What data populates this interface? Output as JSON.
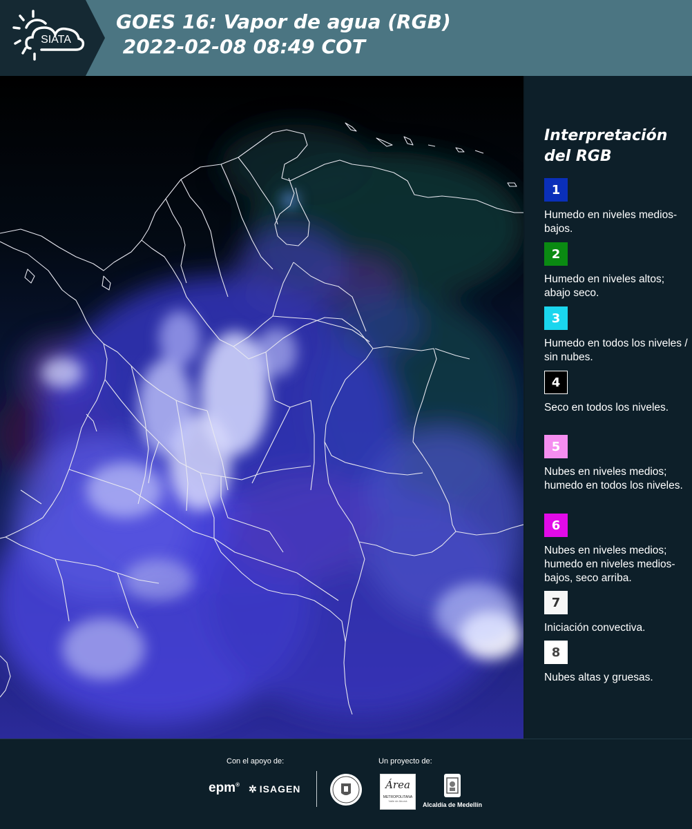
{
  "header": {
    "logo_text": "SIATA",
    "title_line1": "GOES 16: Vapor de agua (RGB)",
    "title_line2": " 2022-02-08 08:49 COT"
  },
  "legend": {
    "title": "Interpretación del RGB",
    "items": [
      {
        "number": "1",
        "color": "#0a2fb9",
        "text_color": "#ffffff",
        "text": "Humedo en niveles medios-bajos."
      },
      {
        "number": "2",
        "color": "#0a8a12",
        "text_color": "#ffffff",
        "text": "Humedo en niveles altos; abajo seco."
      },
      {
        "number": "3",
        "color": "#1ad6ee",
        "text_color": "#ffffff",
        "text": "Humedo en todos los niveles / sin nubes."
      },
      {
        "number": "4",
        "color": "#000000",
        "text_color": "#ffffff",
        "text": "Seco en todos los niveles."
      },
      {
        "number": "5",
        "color": "#f58ef0",
        "text_color": "#ffffff",
        "text": "Nubes en niveles medios; humedo en todos los niveles."
      },
      {
        "number": "6",
        "color": "#e20ae8",
        "text_color": "#ffffff",
        "text": "Nubes en niveles medios; humedo en niveles medios-bajos, seco arriba."
      },
      {
        "number": "7",
        "color": "#f7f7f7",
        "text_color": "#333333",
        "text": "Iniciación convectiva."
      },
      {
        "number": "8",
        "color": "#ffffff",
        "text_color": "#444444",
        "text": "Nubes altas y gruesas."
      }
    ]
  },
  "footer": {
    "support_label": "Con el apoyo de:",
    "project_label": "Un proyecto de:",
    "sponsor_epm": "epm",
    "sponsor_isagen": "ISAGEN",
    "sponsor_area_line1": "Área",
    "sponsor_area_line2": "METROPOLITANA",
    "sponsor_area_line3": "Valle de Aburrá",
    "sponsor_alcaldia": "Alcaldía de Medellín"
  }
}
